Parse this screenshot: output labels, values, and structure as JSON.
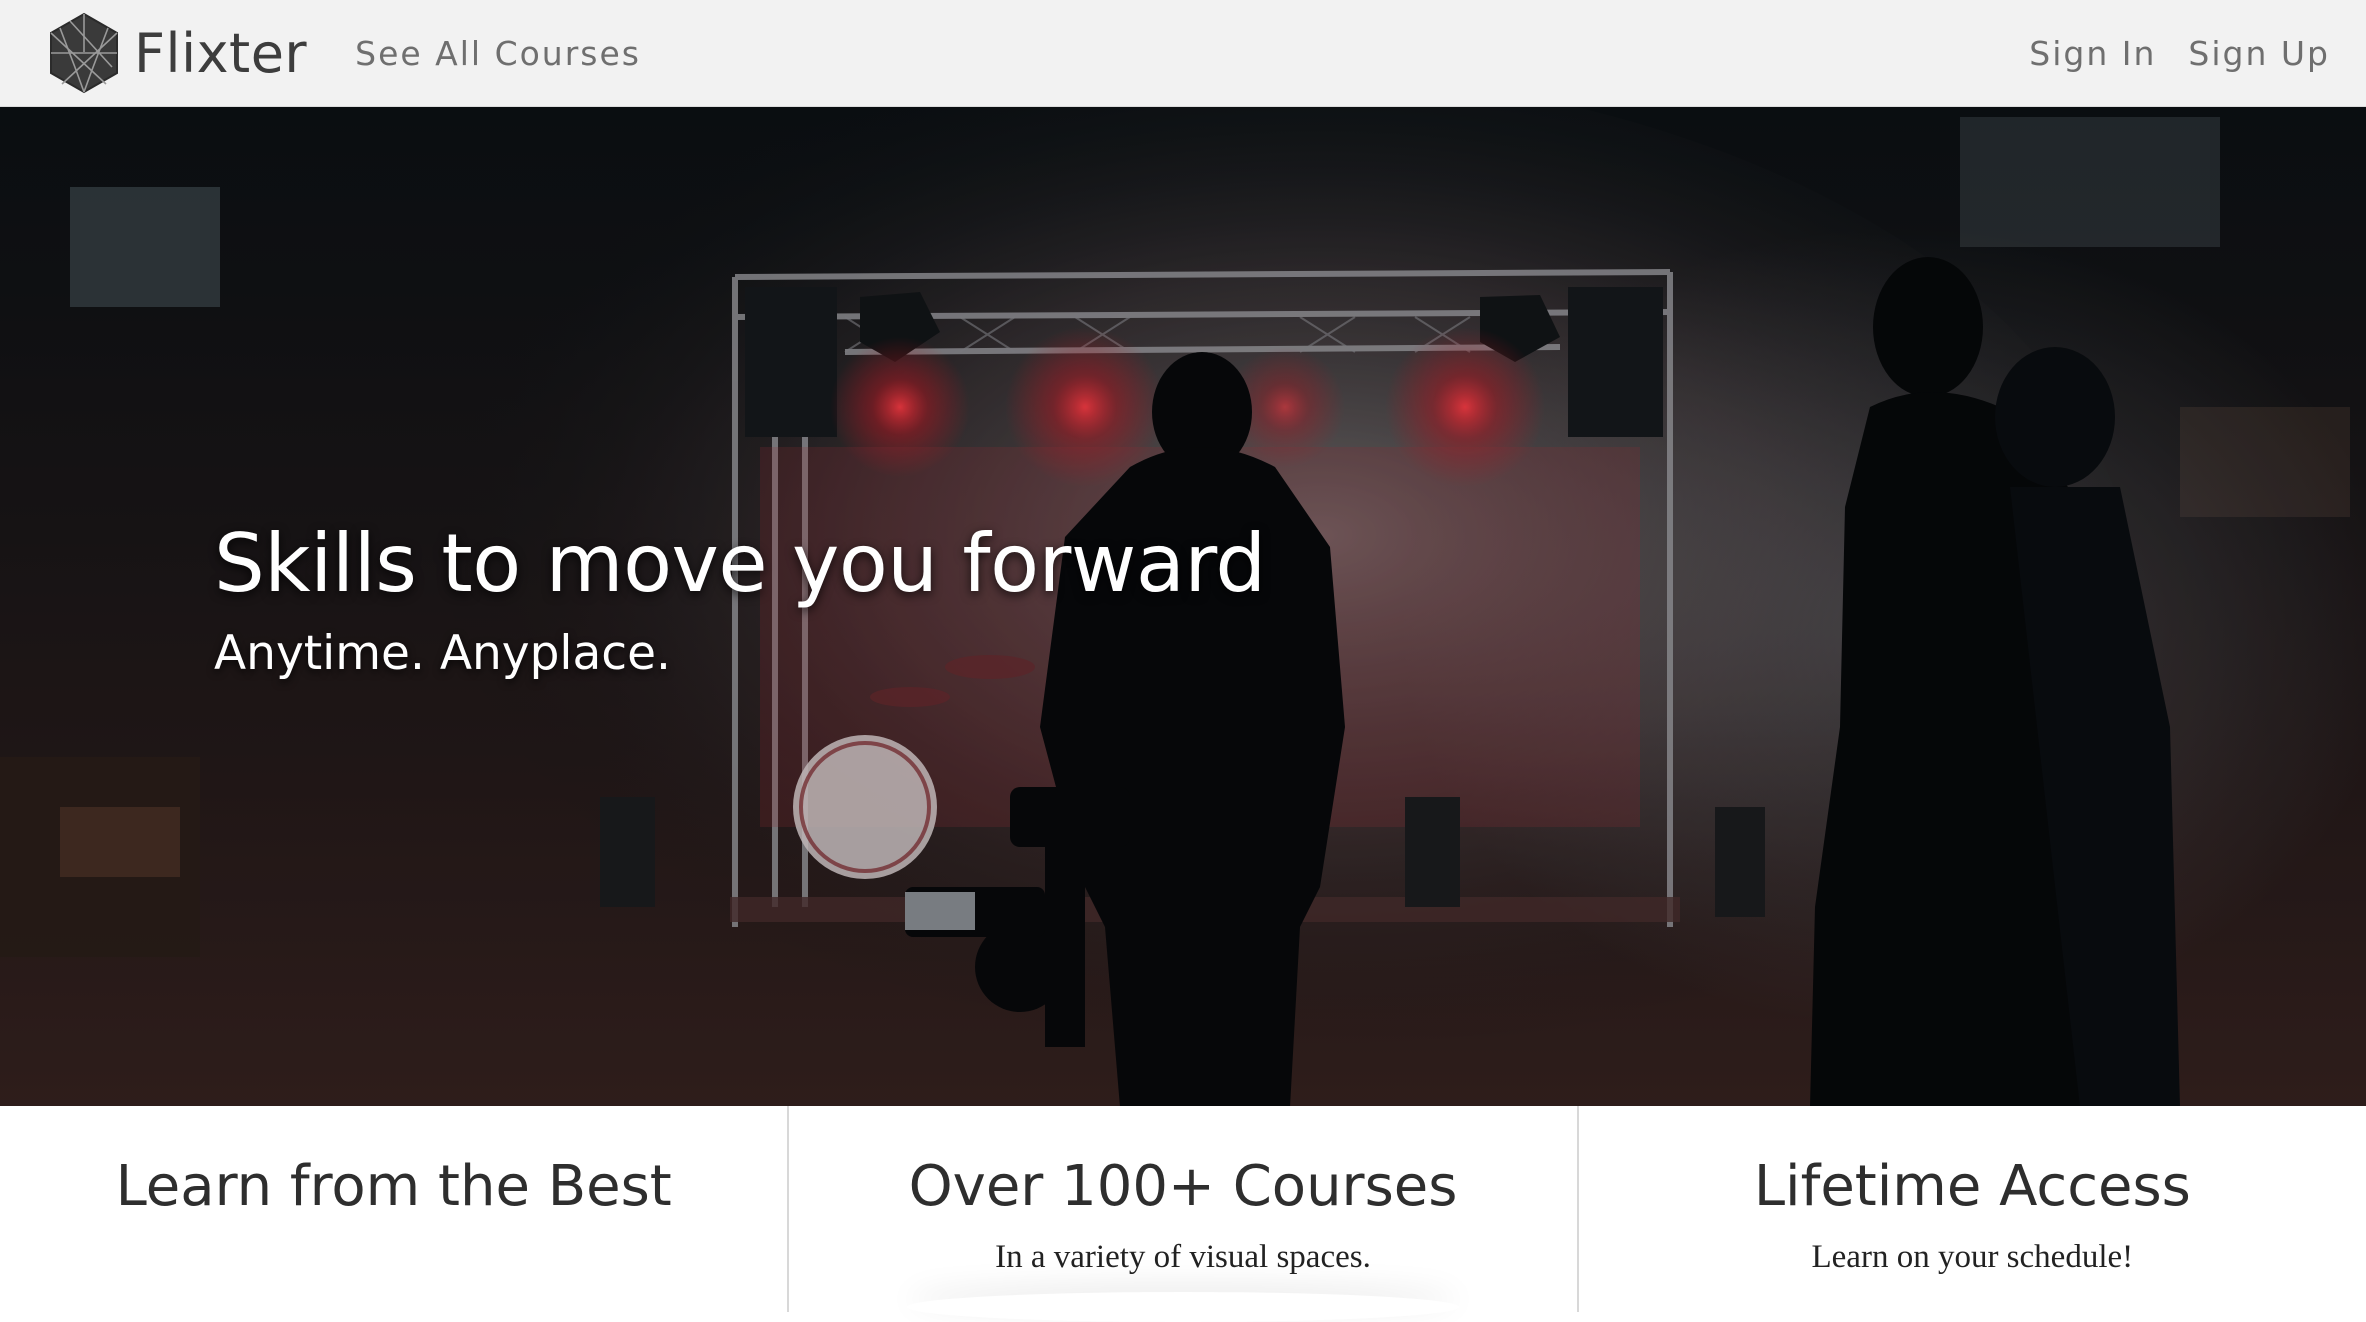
{
  "nav": {
    "brand": "Flixter",
    "all_courses": "See All Courses",
    "sign_in": "Sign In",
    "sign_up": "Sign Up"
  },
  "hero": {
    "title": "Skills to move you forward",
    "subtitle": "Anytime. Anyplace."
  },
  "features": [
    {
      "title": "Learn from the Best",
      "subtitle": ""
    },
    {
      "title": "Over 100+ Courses",
      "subtitle": "In a variety of visual spaces."
    },
    {
      "title": "Lifetime Access",
      "subtitle": "Learn on your schedule!"
    }
  ],
  "colors": {
    "nav_background": "#f2f2f2",
    "nav_link": "#6f6f6f",
    "brand_text": "#3d3d3d",
    "hero_text": "#ffffff",
    "stage_light_red": "#d81e2a",
    "feature_text": "#2e2e2e"
  },
  "icons": {
    "logo": "faceted-hexagon-icon"
  }
}
